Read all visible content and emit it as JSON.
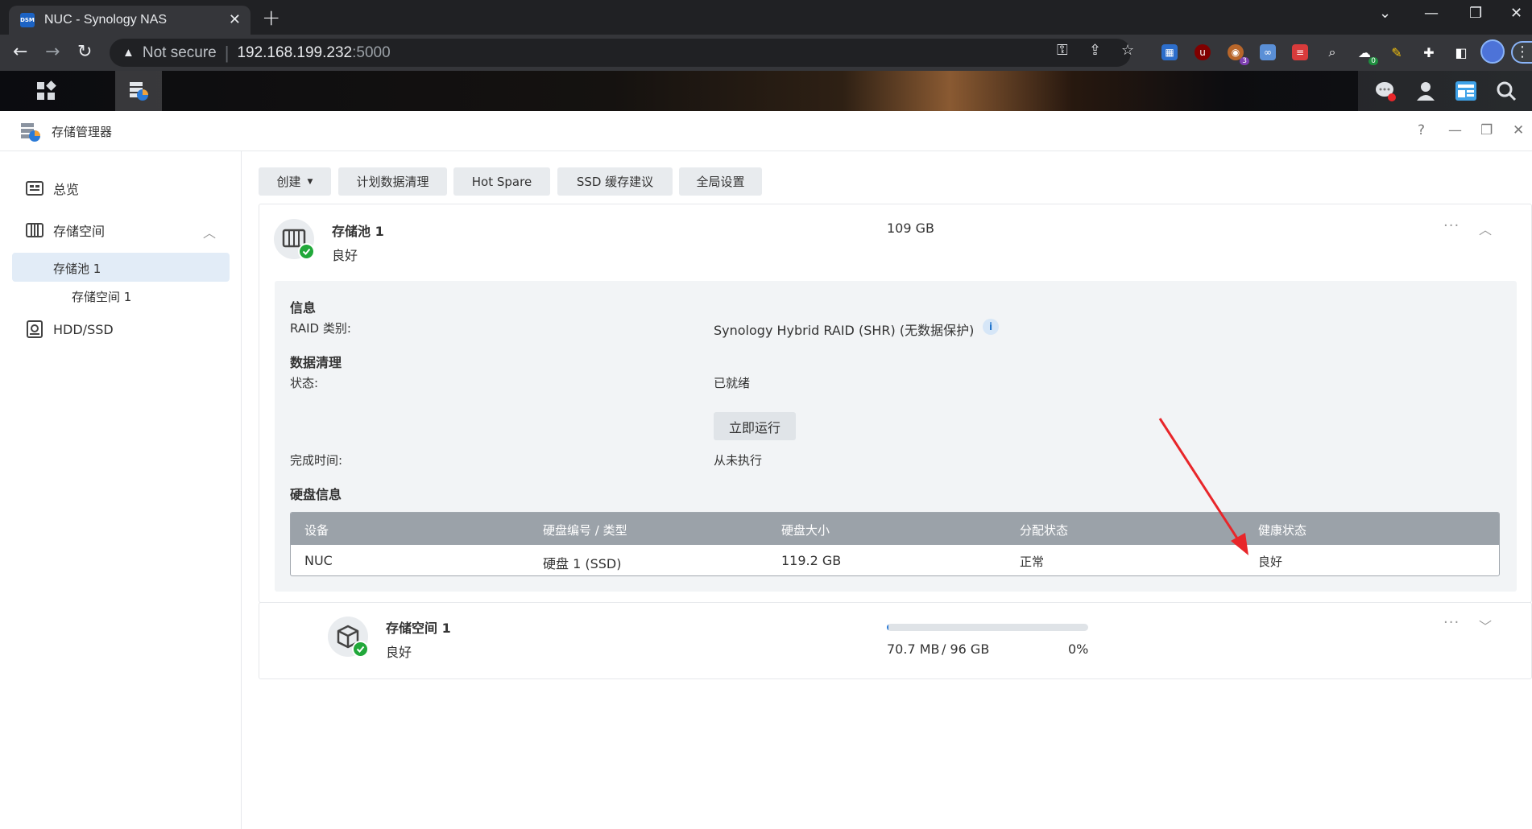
{
  "browser": {
    "tab_title": "NUC - Synology NAS",
    "favicon_text": "DSM",
    "not_secure": "Not secure",
    "url_host": "192.168.199.232",
    "url_port": ":5000",
    "ext_badge_1": "3",
    "ext_badge_2": "0"
  },
  "app": {
    "title": "存储管理器",
    "help": "?"
  },
  "sidebar": {
    "overview": "总览",
    "storage": "存储空间",
    "pool": "存储池 1",
    "volume": "存储空间 1",
    "hdd": "HDD/SSD"
  },
  "toolbar": {
    "create": "创建",
    "schedule": "计划数据清理",
    "hotspare": "Hot Spare",
    "ssd": "SSD 缓存建议",
    "global": "全局设置"
  },
  "pool": {
    "name": "存储池 1",
    "status": "良好",
    "size": "109 GB",
    "info_title": "信息",
    "raid_label": "RAID 类别:",
    "raid_value": "Synology Hybrid RAID (SHR) (无数据保护)",
    "scrub_title": "数据清理",
    "state_label": "状态:",
    "state_value": "已就绪",
    "run_now": "立即运行",
    "finish_label": "完成时间:",
    "finish_value": "从未执行",
    "disk_title": "硬盘信息",
    "disk_headers": [
      "设备",
      "硬盘编号 / 类型",
      "硬盘大小",
      "分配状态",
      "健康状态"
    ],
    "disk_row": [
      "NUC",
      "硬盘 1 (SSD)",
      "119.2 GB",
      "正常",
      "良好"
    ]
  },
  "volume": {
    "name": "存储空间 1",
    "status": "良好",
    "used": "70.7 MB",
    "total": "/ 96 GB",
    "percent": "0%",
    "usage_fraction": 0.00074
  },
  "colors": {
    "good": "#1f9a2e",
    "accent": "#1f74cc",
    "annotation": "#e8262a"
  }
}
